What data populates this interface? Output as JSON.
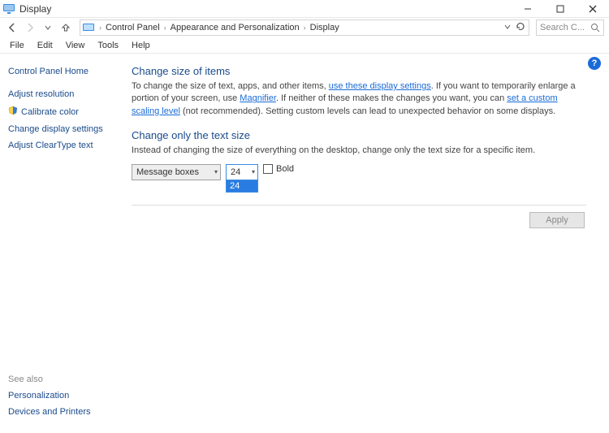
{
  "window": {
    "title": "Display"
  },
  "breadcrumb": {
    "root": "Control Panel",
    "section": "Appearance and Personalization",
    "page": "Display"
  },
  "search": {
    "placeholder": "Search C..."
  },
  "menu": {
    "file": "File",
    "edit": "Edit",
    "view": "View",
    "tools": "Tools",
    "help": "Help"
  },
  "sidebar": {
    "home": "Control Panel Home",
    "adjust": "Adjust resolution",
    "calibrate": "Calibrate color",
    "change_display": "Change display settings",
    "cleartype": "Adjust ClearType text",
    "seealso": "See also",
    "personalization": "Personalization",
    "devices": "Devices and Printers"
  },
  "main": {
    "h1": "Change size of items",
    "p1a": "To change the size of text, apps, and other items, ",
    "p1link1": "use these display settings",
    "p1b": ".  If you want to temporarily enlarge a portion of your screen, use ",
    "p1link2": "Magnifier",
    "p1c": ".  If neither of these makes the changes you want, you can ",
    "p1link3": "set a custom scaling level",
    "p1d": " (not recommended).  Setting custom levels can lead to unexpected behavior on some displays.",
    "h2": "Change only the text size",
    "p2": "Instead of changing the size of everything on the desktop, change only the text size for a specific item.",
    "item_combo": "Message boxes",
    "size_combo": "24",
    "dropdown_opt": "24",
    "bold": "Bold",
    "apply": "Apply"
  }
}
